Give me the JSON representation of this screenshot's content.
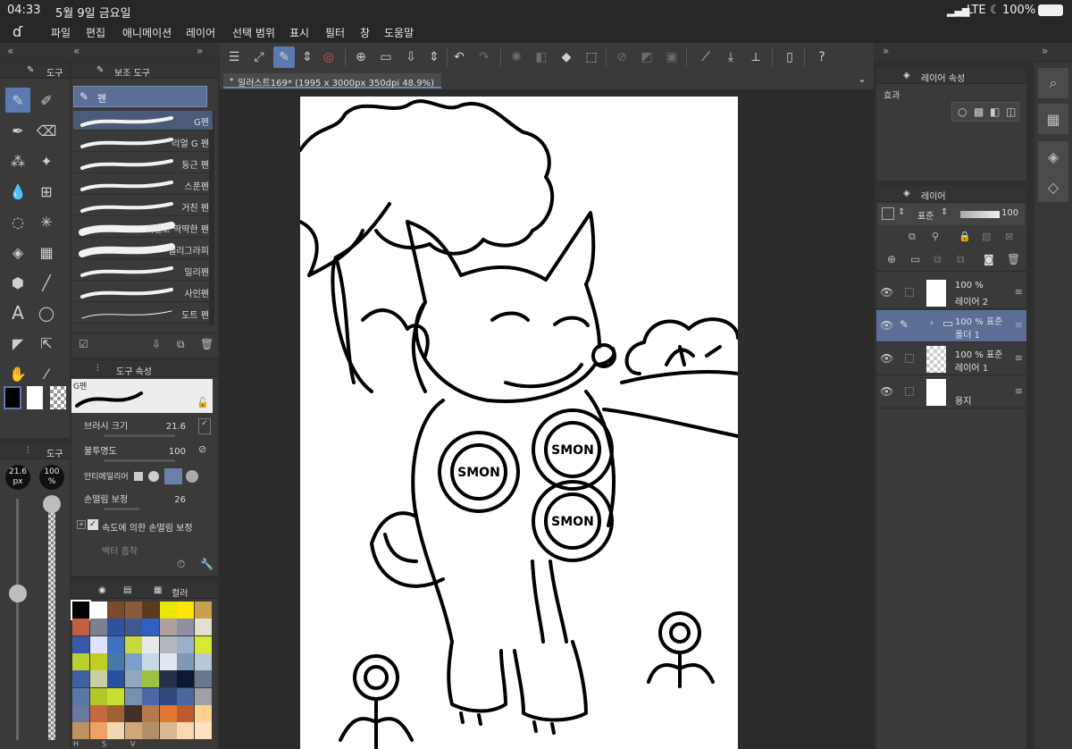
{
  "status": {
    "time": "04:33",
    "date": "5월 9일 금요일",
    "network": "LTE",
    "battery": "100%"
  },
  "menu": [
    "파일",
    "편집",
    "애니메이션",
    "레이어",
    "선택 범위",
    "표시",
    "필터",
    "창",
    "도움말"
  ],
  "tool_panel": {
    "title": "도구"
  },
  "subtool_panel": {
    "title": "보조 도구",
    "group": "펜",
    "brushes": [
      "G펜",
      "리얼 G 펜",
      "둥근 펜",
      "스푼펜",
      "거친 펜",
      "거칠고 딱딱한 펜",
      "캘리그라피",
      "밀리펜",
      "사인펜",
      "도트 펜"
    ],
    "selected": "G펜"
  },
  "tool_props": {
    "title": "도구 속성",
    "brush": "G펜",
    "brush_size_label": "브러시 크기",
    "brush_size": "21.6",
    "opacity_label": "불투명도",
    "opacity": "100",
    "antialias_label": "안티에일리어",
    "stabilize_label": "손떨림 보정",
    "stabilize": "26",
    "speed_stabilize_label": "속도에 의한 손떨림 보정",
    "vector_label": "벡터 흡착"
  },
  "brush_size_panel": {
    "title": "도구",
    "size": "21.6",
    "size_unit": "px",
    "opacity": "100",
    "opacity_unit": "%"
  },
  "color_panel": {
    "title": "컬러",
    "footer": [
      "H",
      "S",
      "V"
    ],
    "swatches": [
      "#000000",
      "#ffffff",
      "#7a4a2a",
      "#8b5a3c",
      "#5c3a1e",
      "#e6e600",
      "#ffe600",
      "#c8a050",
      "#c06040",
      "#7a8090",
      "#3050a0",
      "#405890",
      "#3060c0",
      "#b0a0a0",
      "#9090a0",
      "#e0e0d0",
      "#3858a8",
      "#e0e0ff",
      "#4070c0",
      "#c8d840",
      "#e8e8e8",
      "#b0b8c0",
      "#9ab0c8",
      "#d8e830",
      "#b8d030",
      "#c0d020",
      "#4878a8",
      "#78a0c8",
      "#c8d8e8",
      "#e0e8f0",
      "#8098b0",
      "#b8c8d8",
      "#4060a0",
      "#c8d0a0",
      "#2850a0",
      "#90a8c0",
      "#a0c040",
      "#283048",
      "#0c1830",
      "#687890",
      "#5878a8",
      "#b0c828",
      "#c8e030",
      "#7890b0",
      "#4868a8",
      "#30487a",
      "#4868a0",
      "#a0a0a8",
      "#6878a0",
      "#c86840",
      "#a06030",
      "#403028",
      "#b87850",
      "#e07830",
      "#c05830",
      "#ffd090",
      "#c09060",
      "#f0a060",
      "#f0d8b0",
      "#d0a878",
      "#b09068",
      "#d8b890",
      "#f8d8b0",
      "#ffe0c0"
    ]
  },
  "document_tab": {
    "title": "일러스트169* (1995 x 3000px 350dpi 48.9%)"
  },
  "canvas": {
    "badge_text": "SMON"
  },
  "layer_props": {
    "title": "레이어 속성",
    "effect_label": "효과"
  },
  "layer_panel": {
    "title": "레이어",
    "blend_mode": "표준",
    "opacity": "100",
    "layers": [
      {
        "percent": "100 %",
        "name": "레이어 2",
        "selected": false
      },
      {
        "percent": "100 % 표준",
        "name": "폴더 1",
        "selected": true
      },
      {
        "percent": "100 % 표준",
        "name": "레이어 1",
        "selected": false
      },
      {
        "percent": "",
        "name": "용지",
        "selected": false
      }
    ]
  }
}
